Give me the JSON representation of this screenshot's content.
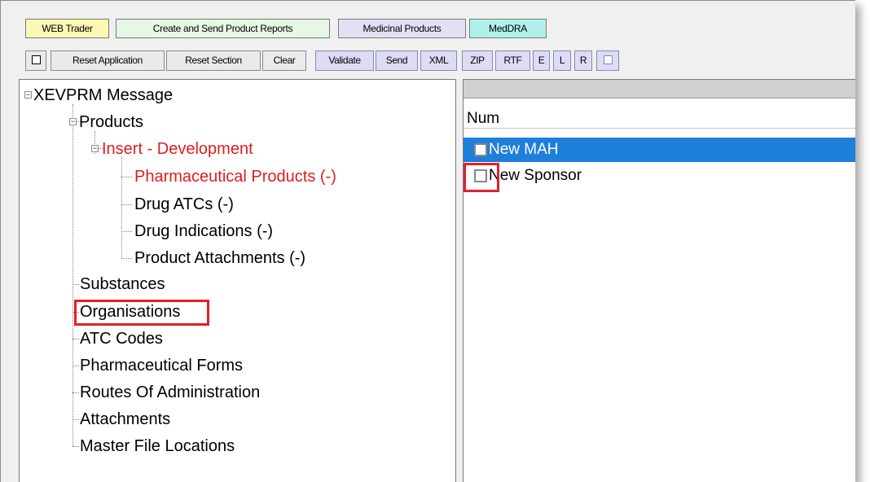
{
  "tabs": {
    "web_trader": "WEB Trader",
    "create_send": "Create and Send Product Reports",
    "medicinal": "Medicinal Products",
    "meddra": "MedDRA"
  },
  "toolbar": {
    "reset_application": "Reset Application",
    "reset_section": "Reset Section",
    "clear": "Clear",
    "validate": "Validate",
    "send": "Send",
    "xml": "XML",
    "zip": "ZIP",
    "rtf": "RTF",
    "e": "E",
    "l": "L",
    "r": "R"
  },
  "tree": {
    "root": "XEVPRM Message",
    "products": "Products",
    "insert_development": "Insert - Development",
    "pharmaceutical_products": "Pharmaceutical Products (-)",
    "drug_atcs": "Drug ATCs (-)",
    "drug_indications": "Drug Indications (-)",
    "product_attachments": "Product Attachments (-)",
    "substances": "Substances",
    "organisations": "Organisations",
    "atc_codes": "ATC Codes",
    "pharmaceutical_forms": "Pharmaceutical Forms",
    "routes_of_administration": "Routes Of Administration",
    "attachments": "Attachments",
    "master_file_locations": "Master File Locations",
    "expanded_glyph": "−"
  },
  "list": {
    "header_num": "Num",
    "rows": [
      {
        "label": "New MAH",
        "selected": true
      },
      {
        "label": "New Sponsor",
        "selected": false
      }
    ]
  },
  "colors": {
    "tab_web_trader": "#fbf8b4",
    "tab_create_send": "#e6f7e6",
    "tab_medicinal": "#e4e0f4",
    "tab_meddra": "#b0f0ea",
    "selection": "#1e7fdb",
    "highlight_box": "#e0202c",
    "tree_red_text": "#e01c1c"
  }
}
